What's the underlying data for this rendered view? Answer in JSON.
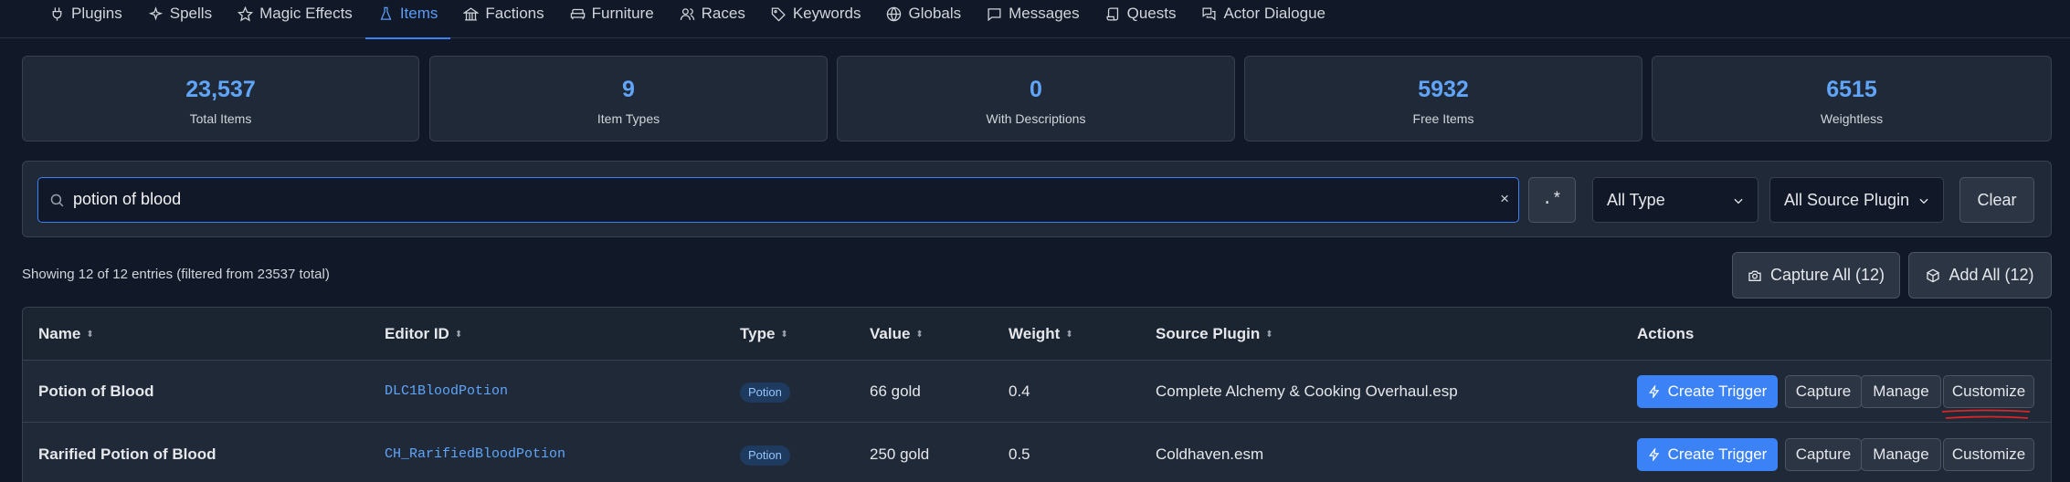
{
  "nav": {
    "tabs": [
      {
        "label": "Plugins",
        "icon": "plug-icon"
      },
      {
        "label": "Spells",
        "icon": "sparkle-icon"
      },
      {
        "label": "Magic Effects",
        "icon": "star-icon"
      },
      {
        "label": "Items",
        "icon": "flask-icon"
      },
      {
        "label": "Factions",
        "icon": "landmark-icon"
      },
      {
        "label": "Furniture",
        "icon": "sofa-icon"
      },
      {
        "label": "Races",
        "icon": "users-icon"
      },
      {
        "label": "Keywords",
        "icon": "tag-icon"
      },
      {
        "label": "Globals",
        "icon": "globe-icon"
      },
      {
        "label": "Messages",
        "icon": "message-icon"
      },
      {
        "label": "Quests",
        "icon": "scroll-icon"
      },
      {
        "label": "Actor Dialogue",
        "icon": "chat-icon"
      }
    ],
    "active": "Items"
  },
  "stats": [
    {
      "value": "23,537",
      "label": "Total Items"
    },
    {
      "value": "9",
      "label": "Item Types"
    },
    {
      "value": "0",
      "label": "With Descriptions"
    },
    {
      "value": "5932",
      "label": "Free Items"
    },
    {
      "value": "6515",
      "label": "Weightless"
    }
  ],
  "filters": {
    "search_value": "potion of blood",
    "clear_glyph": "×",
    "regex_label": ".*",
    "type_select": "All Type",
    "source_select": "All Source Plugin",
    "clear_label": "Clear"
  },
  "results": {
    "showing_text": "Showing 12 of 12 entries (filtered from 23537 total)",
    "capture_all_label": "Capture All (12)",
    "add_all_label": "Add All (12)"
  },
  "table": {
    "headers": {
      "name": "Name",
      "editor_id": "Editor ID",
      "type": "Type",
      "value": "Value",
      "weight": "Weight",
      "source": "Source Plugin",
      "actions": "Actions"
    },
    "sort_glyph": "⬍",
    "buttons": {
      "create": "Create Trigger",
      "capture": "Capture",
      "manage": "Manage",
      "customize": "Customize"
    },
    "rows": [
      {
        "name": "Potion of Blood",
        "editor_id": "DLC1BloodPotion",
        "type": "Potion",
        "value": "66 gold",
        "weight": "0.4",
        "source": "Complete Alchemy & Cooking Overhaul.esp"
      },
      {
        "name": "Rarified Potion of Blood",
        "editor_id": "CH_RarifiedBloodPotion",
        "type": "Potion",
        "value": "250 gold",
        "weight": "0.5",
        "source": "Coldhaven.esm"
      }
    ]
  },
  "colors": {
    "accent": "#3b82f6",
    "stat_value": "#60a5fa",
    "background": "#111827",
    "panel": "#1f2937",
    "annotation_underline": "#dc2626"
  }
}
